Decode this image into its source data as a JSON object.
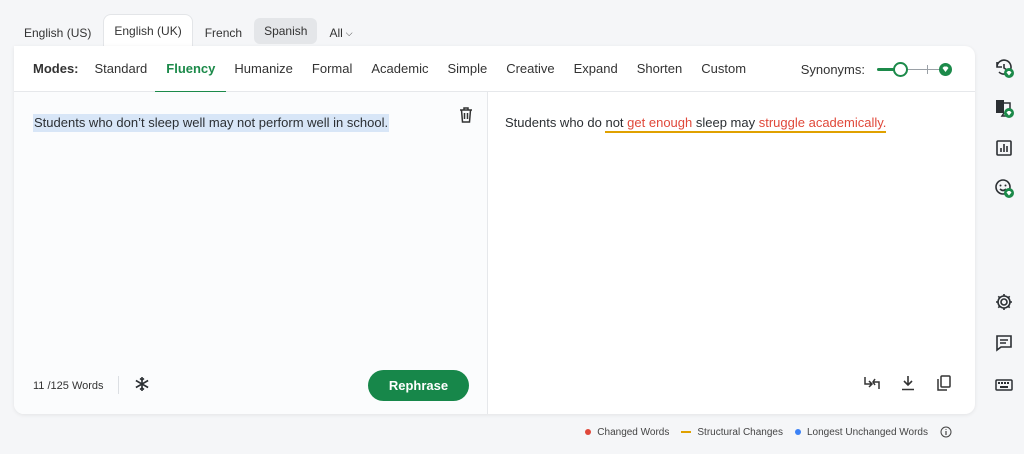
{
  "languages": [
    "English (US)",
    "English (UK)",
    "French",
    "Spanish"
  ],
  "languages_all": "All",
  "modes_label": "Modes:",
  "modes": [
    "Standard",
    "Fluency",
    "Humanize",
    "Formal",
    "Academic",
    "Simple",
    "Creative",
    "Expand",
    "Shorten",
    "Custom"
  ],
  "active_mode": "Fluency",
  "synonyms_label": "Synonyms:",
  "synonyms_level": 0.25,
  "input_text": "Students who don’t sleep well may not perform well in school.",
  "word_count": "11 /125 Words",
  "rephrase_label": "Rephrase",
  "output": {
    "seg1": "Students who do ",
    "seg2": "not",
    "seg3": " ",
    "seg4": "get enough",
    "seg5": " sleep may ",
    "seg6": "struggle academically."
  },
  "legend": {
    "changed": "Changed Words",
    "structural": "Structural Changes",
    "unchanged": "Longest Unchanged Words"
  },
  "colors": {
    "accent": "#1c8a4a",
    "changed": "#e0483a",
    "structural": "#e0a100",
    "unchanged": "#3b82f6",
    "highlight": "#d8e6f7"
  },
  "icons": {
    "input": [
      "trash-icon",
      "freeze-snowflake-icon"
    ],
    "output": [
      "compare-icon",
      "download-icon",
      "copy-icon"
    ],
    "sidebar": [
      "history-icon",
      "translate-icon",
      "statistics-icon",
      "tone-icon",
      "settings-icon",
      "feedback-icon",
      "keyboard-icon"
    ]
  }
}
